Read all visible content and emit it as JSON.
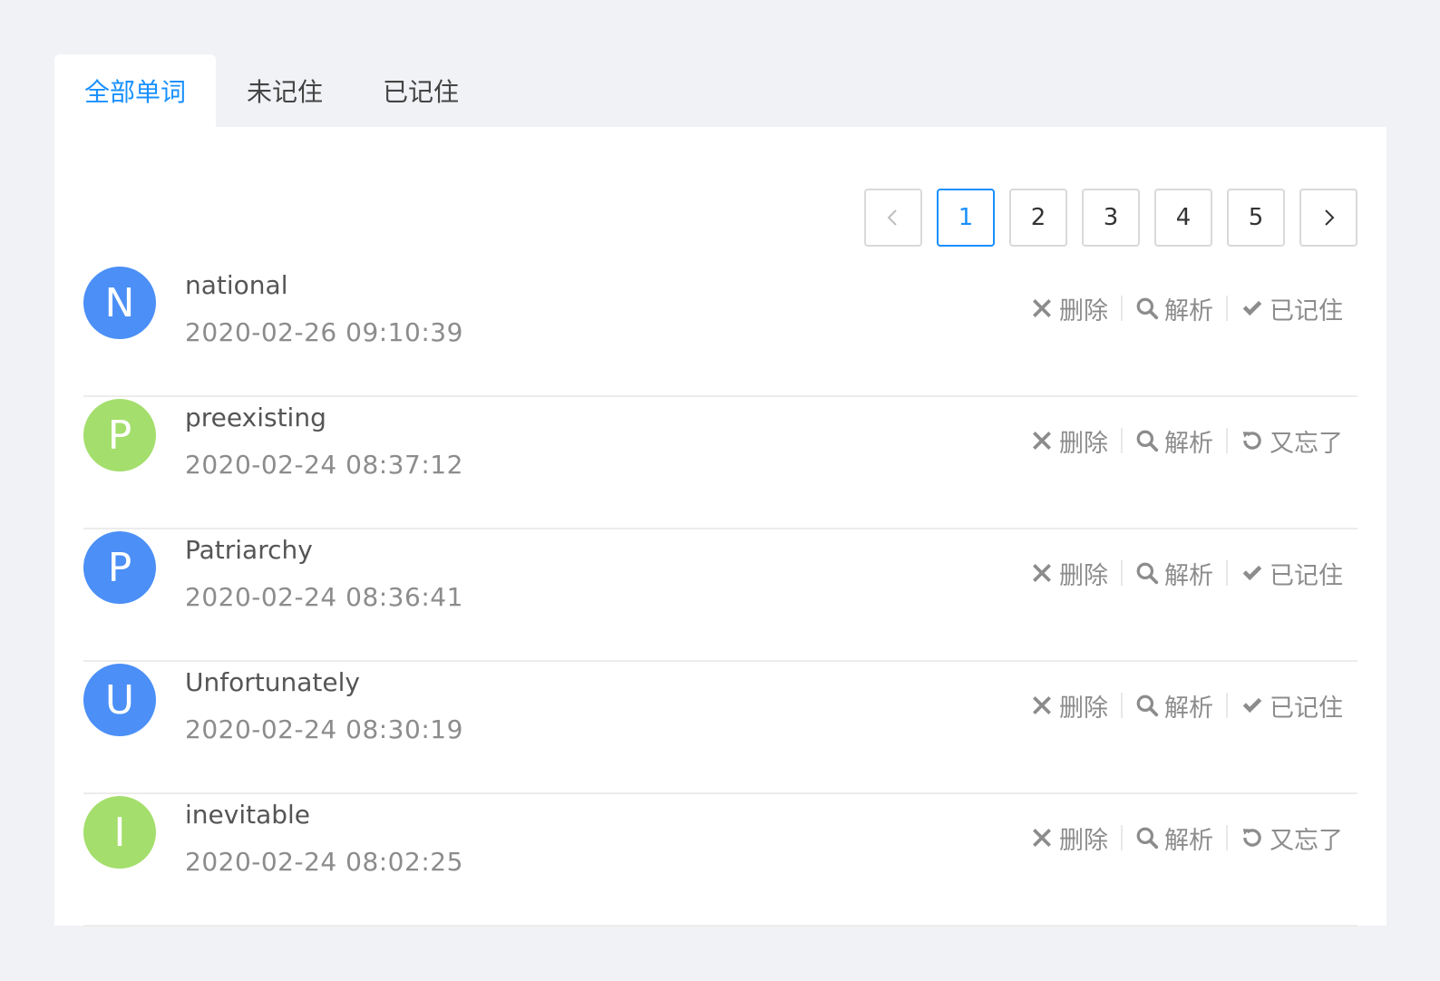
{
  "tabs": [
    {
      "label": "全部单词",
      "active": true
    },
    {
      "label": "未记住",
      "active": false
    },
    {
      "label": "已记住",
      "active": false
    }
  ],
  "pagination": {
    "prev_icon": "chevron-left-icon",
    "next_icon": "chevron-right-icon",
    "pages": [
      "1",
      "2",
      "3",
      "4",
      "5"
    ],
    "current": "1"
  },
  "colors": {
    "accent": "#1890ff",
    "avatar_blue": "#4b8ff7",
    "avatar_green": "#a4de6c"
  },
  "actions": {
    "delete_label": "删除",
    "analyze_label": "解析",
    "remembered_label": "已记住",
    "forgot_label": "又忘了"
  },
  "words": [
    {
      "initial": "N",
      "word": "national",
      "time": "2020-02-26 09:10:39",
      "avatar_color": "blue",
      "toggle": "remembered"
    },
    {
      "initial": "P",
      "word": "preexisting",
      "time": "2020-02-24 08:37:12",
      "avatar_color": "green",
      "toggle": "forgot"
    },
    {
      "initial": "P",
      "word": "Patriarchy",
      "time": "2020-02-24 08:36:41",
      "avatar_color": "blue",
      "toggle": "remembered"
    },
    {
      "initial": "U",
      "word": "Unfortunately",
      "time": "2020-02-24 08:30:19",
      "avatar_color": "blue",
      "toggle": "remembered"
    },
    {
      "initial": "I",
      "word": "inevitable",
      "time": "2020-02-24 08:02:25",
      "avatar_color": "green",
      "toggle": "forgot"
    }
  ]
}
